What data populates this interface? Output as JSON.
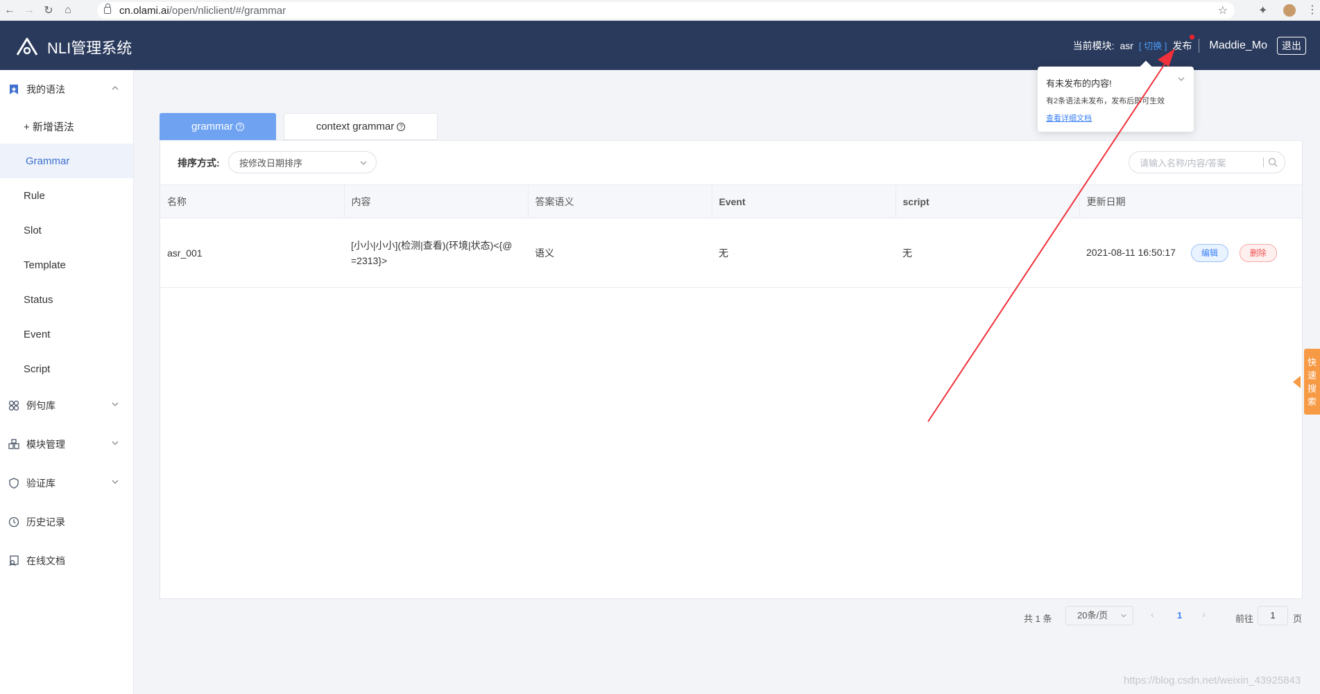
{
  "browser": {
    "url_host": "cn.olami.ai",
    "url_path": "/open/nliclient/#/grammar"
  },
  "header": {
    "app_title": "NLI管理系统",
    "module_label": "当前模块:",
    "module_name": "asr",
    "switch_label": "[ 切换 ]",
    "publish_label": "发布",
    "username": "Maddie_Mo",
    "logout_label": "退出"
  },
  "sidebar": {
    "my_grammar": "我的语法",
    "add_grammar": "+ 新增语法",
    "items": [
      "Grammar",
      "Rule",
      "Slot",
      "Template",
      "Status",
      "Event",
      "Script"
    ],
    "active": "Grammar",
    "groups": [
      "例句库",
      "模块管理",
      "验证库",
      "历史记录",
      "在线文档"
    ]
  },
  "tabs": [
    {
      "label": "grammar",
      "active": true
    },
    {
      "label": "context grammar",
      "active": false
    }
  ],
  "toolbar": {
    "sort_label": "排序方式:",
    "sort_value": "按修改日期排序",
    "search_placeholder": "请输入名称/内容/答案"
  },
  "table": {
    "columns": [
      "名称",
      "内容",
      "答案语义",
      "Event",
      "script",
      "更新日期"
    ],
    "rows": [
      {
        "name": "asr_001",
        "content_line1": "[小小|小小](检测|查看)(环境|状态)<{@",
        "content_line2": "=2313}>",
        "answer": "语义",
        "event": "无",
        "script": "无",
        "updated": "2021-08-11 16:50:17",
        "edit_label": "编辑",
        "delete_label": "删除"
      }
    ]
  },
  "pagination": {
    "total": "共 1 条",
    "page_size": "20条/页",
    "current_page": "1",
    "goto_label": "前往",
    "goto_value": "1",
    "page_suffix": "页"
  },
  "popover": {
    "title": "有未发布的内容!",
    "message": "有2条语法未发布，发布后即可生效",
    "link": "查看详细文档"
  },
  "quick_search": [
    "快",
    "速",
    "搜",
    "索"
  ],
  "watermark": "https://blog.csdn.net/weixin_43925843",
  "colors": {
    "header_bg": "#2a3a5c",
    "accent": "#6fa3f2",
    "annotation_arrow": "#f0303a",
    "quick_tab": "#f79a45"
  }
}
